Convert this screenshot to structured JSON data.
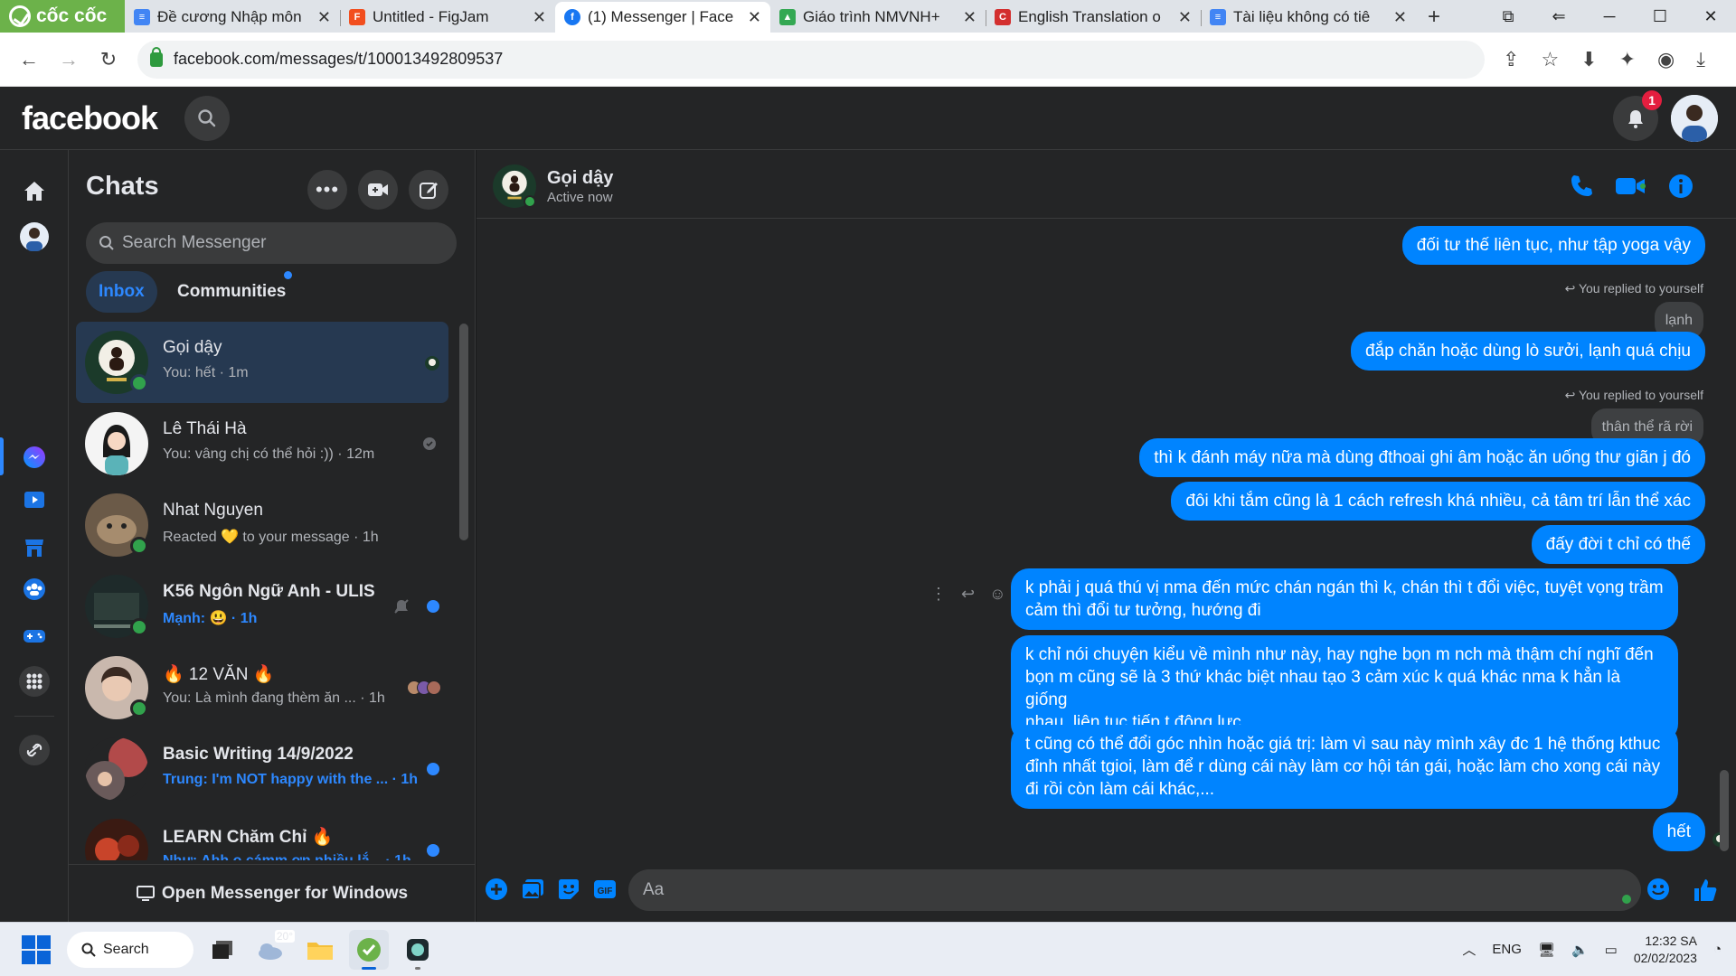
{
  "browser": {
    "brand": "cốc cốc",
    "tabs": [
      {
        "title": "Đề cương Nhập môn",
        "icon": "docs-icon",
        "color": "#4285f4"
      },
      {
        "title": "Untitled - FigJam",
        "icon": "figma-icon",
        "color": "#f24e1e"
      },
      {
        "title": "(1) Messenger | Face",
        "icon": "facebook-icon",
        "color": "#1877f2",
        "active": true
      },
      {
        "title": "Giáo trình NMVNH+",
        "icon": "drive-icon",
        "color": "#34a853"
      },
      {
        "title": "English Translation o",
        "icon": "c-icon",
        "color": "#d32f2f"
      },
      {
        "title": "Tài liệu không có tiê",
        "icon": "docs-icon",
        "color": "#4285f4"
      }
    ],
    "url": "facebook.com/messages/t/100013492809537"
  },
  "header": {
    "logo": "facebook",
    "notif_count": "1"
  },
  "chats_panel": {
    "title": "Chats",
    "search_placeholder": "Search Messenger",
    "filter_inbox": "Inbox",
    "filter_communities": "Communities",
    "open_windows": "Open Messenger for Windows",
    "conversations": [
      {
        "name": "Gọi dậy",
        "preview": "You: hết · 1m",
        "online": true,
        "selected": true,
        "unread": false,
        "status": "seen-avatar",
        "avatar": "#1b3a2a"
      },
      {
        "name": "Lê Thái Hà",
        "preview": "You: vâng chị có thể hỏi :)) · 12m",
        "online": false,
        "selected": false,
        "unread": false,
        "status": "delivered",
        "avatar": "#f0f0f0"
      },
      {
        "name": "Nhat Nguyen",
        "preview": "Reacted 💛 to your message · 1h",
        "online": true,
        "selected": false,
        "unread": false,
        "status": "",
        "avatar": "#6b5a48"
      },
      {
        "name": "K56 Ngôn Ngữ Anh - ULIS",
        "preview": "Mạnh: 😃 · 1h",
        "online": true,
        "selected": false,
        "unread": true,
        "status": "muted",
        "avatar": "#2a3a3a"
      },
      {
        "name": "🔥 12 VĂN 🔥",
        "preview": "You: Là mình đang thèm ăn ... · 1h",
        "online": true,
        "selected": false,
        "unread": false,
        "status": "group-seen",
        "avatar": "#a08878"
      },
      {
        "name": "Basic Writing 14/9/2022",
        "preview": "Trung: I'm NOT happy with the ... · 1h",
        "online": false,
        "selected": false,
        "unread": true,
        "status": "",
        "avatar": "#7a4040"
      },
      {
        "name": "LEARN Chăm Chỉ 🔥",
        "preview": "Như: Ahh o cámm ơn nhiều lắ... · 1h",
        "online": false,
        "selected": false,
        "unread": true,
        "status": "",
        "avatar": "#5a2a1a"
      }
    ]
  },
  "conversation": {
    "name": "Gọi dậy",
    "status": "Active now",
    "composer_placeholder": "Aa",
    "accent": "#0084ff",
    "messages": {
      "m1": "đối tư thế liên tục, như tập yoga vậy",
      "r1_note": "You replied to yourself",
      "r1_quote": "lạnh",
      "m2": "đắp chăn hoặc dùng lò sưởi, lạnh quá chịu",
      "r2_note": "You replied to yourself",
      "r2_quote": "thân thể rã rời",
      "m3": "thì k đánh máy nữa mà dùng đthoai ghi âm hoặc ăn uống thư giãn j đó",
      "m4": "đôi khi tắm cũng là 1 cách refresh khá nhiều, cả tâm trí lẫn thể xác",
      "m5": "đấy đời t chỉ có thế",
      "m6": "k phải j quá thú vị nma đến mức chán ngán thì k, chán thì t đổi việc, tuyệt vọng trầm\ncảm thì đổi tư tưởng, hướng đi",
      "m7": "k chỉ nói chuyện kiểu về mình như này, hay nghe bọn m nch mà thậm chí nghĩ đến\nbọn m cũng sẽ là 3 thứ khác biệt nhau tạo 3 cảm xúc k quá khác nma k hẳn là giống\nnhau, liên tục tiếp t động lực",
      "m8": "t cũng có thể đổi góc nhìn hoặc giá trị: làm vì sau này mình xây đc 1 hệ thống kthuc\nđỉnh nhất tgioi, làm để r dùng cái này làm cơ hội tán gái, hoặc làm cho xong cái này\nđi rồi còn làm cái khác,...",
      "m9": "hết"
    }
  },
  "taskbar": {
    "search": "Search",
    "weather": "20°",
    "lang": "ENG",
    "time": "12:32 SA",
    "date": "02/02/2023"
  }
}
